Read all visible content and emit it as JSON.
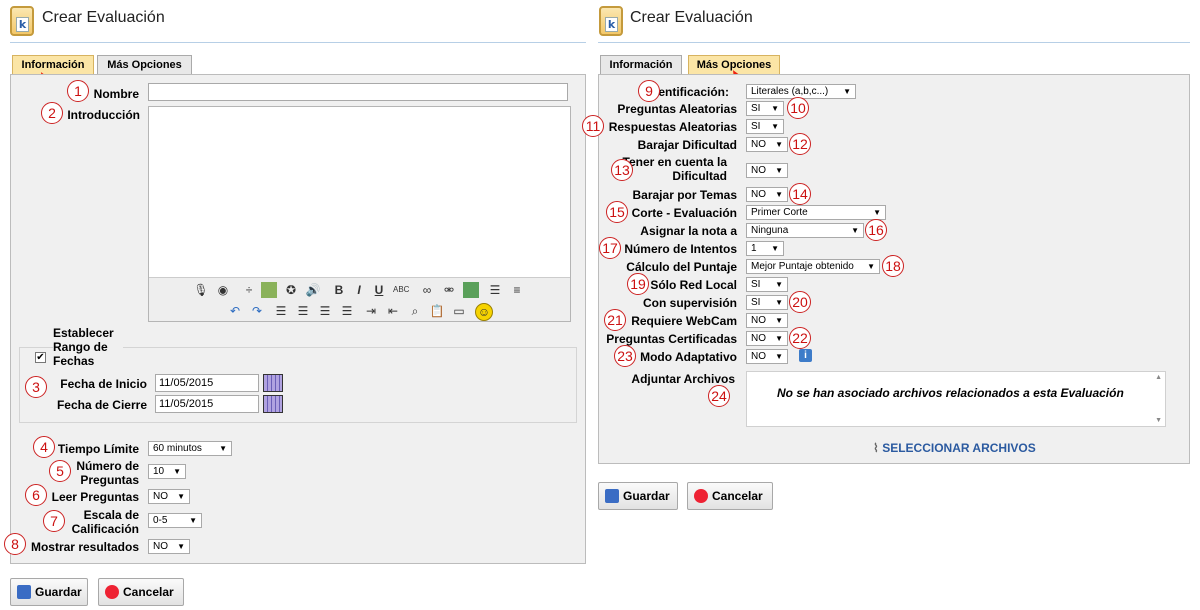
{
  "left": {
    "title": "Crear Evaluación",
    "tabs": [
      "Información",
      "Más Opciones"
    ],
    "fields": {
      "nombre_label": "Nombre",
      "introduccion_label": "Introducción",
      "rango_label": "Establecer Rango de Fechas",
      "rango_checked": true,
      "fecha_inicio_label": "Fecha de Inicio",
      "fecha_inicio_value": "11/05/2015",
      "fecha_cierre_label": "Fecha de Cierre",
      "fecha_cierre_value": "11/05/2015",
      "tiempo_label": "Tiempo Límite",
      "tiempo_value": "60 minutos",
      "numero_label": "Número de Preguntas",
      "numero_value": "10",
      "leer_label": "Leer Preguntas",
      "leer_value": "NO",
      "escala_label": "Escala de Calificación",
      "escala_value": "0-5",
      "mostrar_label": "Mostrar resultados",
      "mostrar_value": "NO"
    },
    "buttons": {
      "save": "Guardar",
      "cancel": "Cancelar"
    },
    "markers": [
      "1",
      "2",
      "3",
      "4",
      "5",
      "6",
      "7",
      "8"
    ]
  },
  "right": {
    "title": "Crear Evaluación",
    "tabs": [
      "Información",
      "Más Opciones"
    ],
    "rows": [
      {
        "label": "Identificación:",
        "value": "Literales (a,b,c...)",
        "marker": "9"
      },
      {
        "label": "Preguntas Aleatorias",
        "value": "SI",
        "marker": "10"
      },
      {
        "label": "Respuestas Aleatorias",
        "value": "SI",
        "marker": "11"
      },
      {
        "label": "Barajar Dificultad",
        "value": "NO",
        "marker": "12"
      },
      {
        "label": "Tener en cuenta la Dificultad",
        "value": "NO",
        "marker": "13"
      },
      {
        "label": "Barajar por Temas",
        "value": "NO",
        "marker": "14"
      },
      {
        "label": "Corte - Evaluación",
        "value": "Primer Corte",
        "marker": "15"
      },
      {
        "label": "Asignar la nota a",
        "value": "Ninguna",
        "marker": "16"
      },
      {
        "label": "Número de Intentos",
        "value": "1",
        "marker": "17"
      },
      {
        "label": "Cálculo del Puntaje",
        "value": "Mejor Puntaje obtenido",
        "marker": "18"
      },
      {
        "label": "Sólo Red Local",
        "value": "SI",
        "marker": "19"
      },
      {
        "label": "Con supervisión",
        "value": "SI",
        "marker": "20"
      },
      {
        "label": "Requiere WebCam",
        "value": "NO",
        "marker": "21"
      },
      {
        "label": "Preguntas Certificadas",
        "value": "NO",
        "marker": "22"
      },
      {
        "label": "Modo Adaptativo",
        "value": "NO",
        "marker": "23"
      }
    ],
    "attach_label": "Adjuntar Archivos",
    "attach_marker": "24",
    "attach_empty": "No se han asociado archivos relacionados a esta Evaluación",
    "select_files": "SELECCIONAR ARCHIVOS",
    "buttons": {
      "save": "Guardar",
      "cancel": "Cancelar"
    }
  },
  "colors": {
    "active_tab": "#fbe5a6",
    "marker": "#cc1111",
    "panel": "#f0f0f0"
  }
}
